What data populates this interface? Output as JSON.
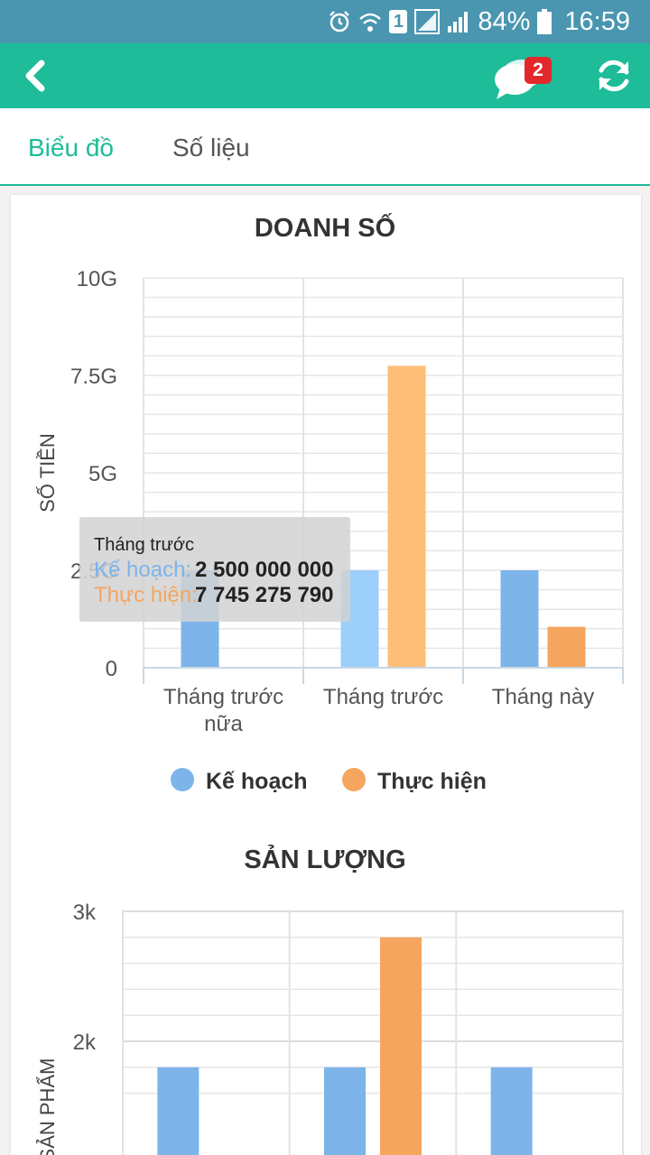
{
  "status_bar": {
    "battery": "84%",
    "time": "16:59",
    "sim": "1",
    "icons": [
      "alarm-icon",
      "wifi-icon",
      "sim-icon",
      "signal-icon",
      "signal-icon",
      "battery-icon"
    ]
  },
  "app_bar": {
    "back_icon": "chevron-left-icon",
    "chat_icon": "chat-bubbles-icon",
    "chat_badge": "2",
    "refresh_icon": "refresh-icon"
  },
  "tabs": [
    {
      "label": "Biểu đồ",
      "active": true
    },
    {
      "label": "Số liệu",
      "active": false
    }
  ],
  "colors": {
    "status_bar": "#4a96b0",
    "app_bar": "#1ebc99",
    "plan": "#7db4ea",
    "plan_highlight": "#9dcffb",
    "actual": "#f6a55e",
    "actual_highlight": "#fdbe78",
    "badge": "#e3282b"
  },
  "tooltip": {
    "title": "Tháng trước",
    "rows": [
      {
        "label": "Kế hoạch:",
        "value": "2 500 000 000",
        "color": "#7db4ea"
      },
      {
        "label": "Thực hiện:",
        "value": "7 745 275 790",
        "color": "#f6a55e"
      }
    ]
  },
  "chart_data": [
    {
      "type": "bar",
      "title": "DOANH SỐ",
      "ylabel": "SỐ TIỀN",
      "categories": [
        "Tháng trước nữa",
        "Tháng trước",
        "Tháng này"
      ],
      "category_lines": [
        [
          "Tháng trước",
          "nữa"
        ],
        [
          "Tháng trước"
        ],
        [
          "Tháng này"
        ]
      ],
      "series": [
        {
          "name": "Kế hoạch",
          "values": [
            2500000000,
            2500000000,
            2500000000
          ],
          "color": "#7db4ea"
        },
        {
          "name": "Thực hiện",
          "values": [
            0,
            7745275790,
            1050000000
          ],
          "color": "#f6a55e"
        }
      ],
      "highlighted_category": 1,
      "ylim": [
        0,
        10000000000
      ],
      "yticks": [
        0,
        2500000000,
        5000000000,
        7500000000,
        10000000000
      ],
      "ytick_labels": [
        "0",
        "2.5G",
        "5G",
        "7.5G",
        "10G"
      ],
      "grid": true,
      "legend": "bottom"
    },
    {
      "type": "bar",
      "title": "SẢN LƯỢNG",
      "ylabel": "SẢN PHẨM",
      "categories": [
        "",
        "",
        ""
      ],
      "series": [
        {
          "name": "Kế hoạch",
          "values": [
            1800,
            1800,
            1800
          ],
          "color": "#7db4ea"
        },
        {
          "name": "Thực hiện",
          "values": [
            0,
            2800,
            0
          ],
          "color": "#f6a55e"
        }
      ],
      "yticks": [
        2000,
        3000
      ],
      "ytick_labels": [
        "2k",
        "3k"
      ],
      "grid": true
    }
  ]
}
